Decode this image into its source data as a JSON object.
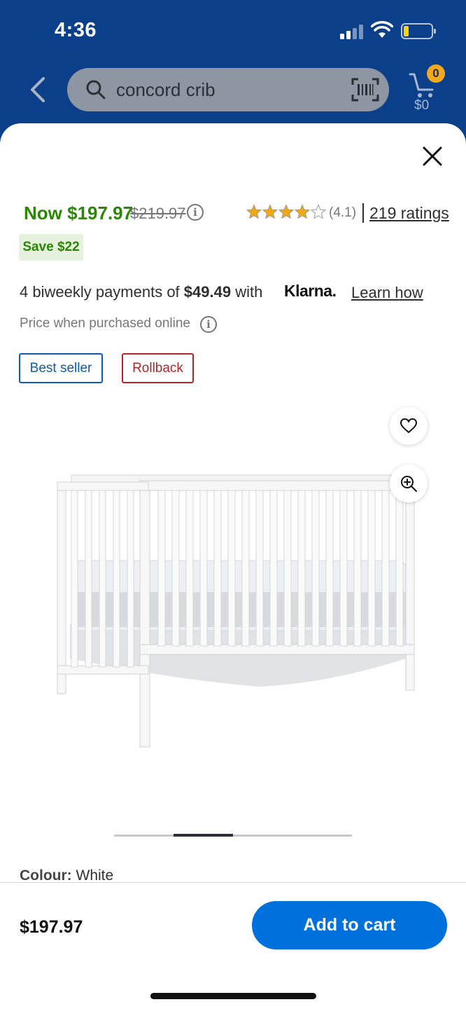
{
  "status_bar": {
    "time": "4:36"
  },
  "header": {
    "search": {
      "query": "concord crib"
    },
    "cart": {
      "count": "0",
      "total": "$0"
    }
  },
  "product": {
    "price_now": "Now $197.97",
    "price_was": "$219.97",
    "rating_value": 4.1,
    "rating_text": "(4.1)",
    "rating_count": "219 ratings",
    "savings": "Save $22",
    "klarna": {
      "text_before": "4 biweekly payments of ",
      "amount": "$49.49",
      "text_after": " with",
      "brand": "Klarna.",
      "learn_link": "Learn how"
    },
    "price_note": "Price when purchased online",
    "tags": {
      "best_seller": "Best seller",
      "rollback": "Rollback"
    },
    "carousel": {
      "images": 4,
      "active": 1
    },
    "colour_label": "Colour:",
    "colour_value": "White"
  },
  "bottom_bar": {
    "price": "$197.97",
    "add_to_cart": "Add to cart"
  },
  "colors": {
    "header_bg": "#0b3f8a",
    "price_green": "#2a8703",
    "walmart_blue": "#0071dc",
    "rollback_red": "#b1262a",
    "star_gold": "#f0a815"
  }
}
